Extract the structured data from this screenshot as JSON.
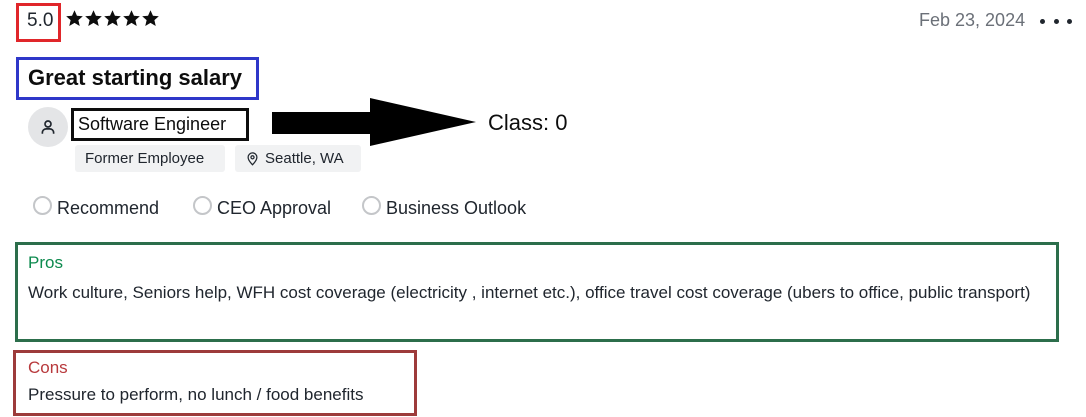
{
  "review": {
    "rating": "5.0",
    "stars": 5,
    "date": "Feb 23, 2024",
    "headline": "Great starting salary",
    "job_title": "Software Engineer",
    "employee_status": "Former Employee",
    "location": "Seattle, WA",
    "approvals": [
      {
        "label": "Recommend"
      },
      {
        "label": "CEO Approval"
      },
      {
        "label": "Business Outlook"
      }
    ],
    "pros": {
      "title": "Pros",
      "text": "Work culture, Seniors help, WFH cost coverage (electricity , internet etc.), office travel cost coverage (ubers to office, public transport)"
    },
    "cons": {
      "title": "Cons",
      "text": "Pressure to perform, no lunch / food benefits"
    }
  },
  "annotation": {
    "class_label": "Class: 0"
  },
  "colors": {
    "rating_box": "#e0262a",
    "headline_box": "#2e37c9",
    "job_box": "#0d0d0d",
    "pros_box": "#2c6e4b",
    "pros_title": "#0d8a4e",
    "cons_box": "#9d3b3b",
    "cons_title": "#b8393c"
  },
  "icons": {
    "menu": "more-horizontal-icon",
    "avatar": "person-icon",
    "location": "map-pin-icon",
    "star": "star-icon",
    "arrow": "arrow-right-icon"
  }
}
